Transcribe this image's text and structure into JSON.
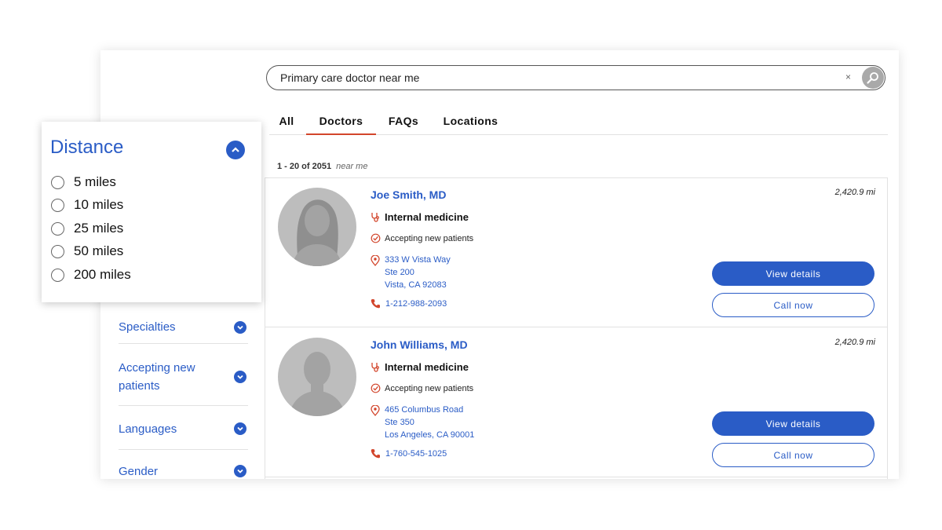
{
  "search": {
    "query": "Primary care doctor near me",
    "clear": "×"
  },
  "tabs": [
    "All",
    "Doctors",
    "FAQs",
    "Locations"
  ],
  "results_count": {
    "range": "1 - 20 of 2051",
    "location": "near me"
  },
  "doctors": [
    {
      "name": "Joe Smith, MD",
      "distance": "2,420.9 mi",
      "specialty": "Internal medicine",
      "accepting": "Accepting new patients",
      "address": [
        "333 W Vista Way",
        "Ste 200",
        "Vista, CA 92083"
      ],
      "phone": "1-212-988-2093",
      "view_label": "View details",
      "call_label": "Call now"
    },
    {
      "name": "John Williams, MD",
      "distance": "2,420.9 mi",
      "specialty": "Internal medicine",
      "accepting": "Accepting new patients",
      "address": [
        "465 Columbus Road",
        "Ste 350",
        "Los Angeles, CA 90001"
      ],
      "phone": "1-760-545-1025",
      "view_label": "View details",
      "call_label": "Call now"
    }
  ],
  "filters": {
    "specialties": "Specialties",
    "accepting_new_patients": [
      "Accepting new",
      "patients"
    ],
    "languages": "Languages",
    "gender": "Gender"
  },
  "distance_filter": {
    "title": "Distance",
    "options": [
      "5 miles",
      "10 miles",
      "25 miles",
      "50 miles",
      "200 miles"
    ]
  },
  "colors": {
    "accent": "#2a5cc6",
    "icon_red": "#d2452b",
    "avatar_gray": "#bdbdbd"
  },
  "icons": [
    "search-icon",
    "clear-icon",
    "stethoscope-icon",
    "check-circle-icon",
    "location-pin-icon",
    "phone-icon",
    "chevron-down-icon",
    "chevron-up-icon"
  ]
}
